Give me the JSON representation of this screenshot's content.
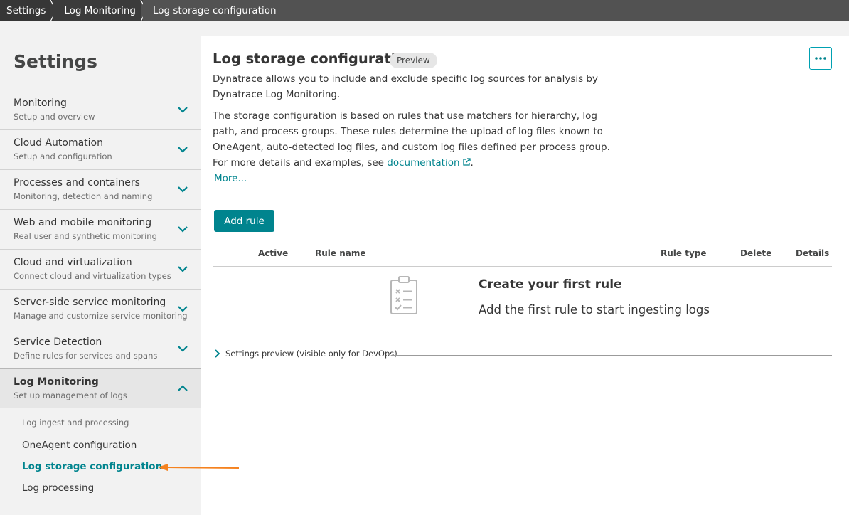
{
  "breadcrumb": {
    "items": [
      "Settings",
      "Log Monitoring",
      "Log storage configuration"
    ]
  },
  "sidebar": {
    "title": "Settings",
    "items": [
      {
        "label": "Monitoring",
        "sub": "Setup and overview"
      },
      {
        "label": "Cloud Automation",
        "sub": "Setup and configuration"
      },
      {
        "label": "Processes and containers",
        "sub": "Monitoring, detection and naming"
      },
      {
        "label": "Web and mobile monitoring",
        "sub": "Real user and synthetic monitoring"
      },
      {
        "label": "Cloud and virtualization",
        "sub": "Connect cloud and virtualization types"
      },
      {
        "label": "Server-side service monitoring",
        "sub": "Manage and customize service monitoring"
      },
      {
        "label": "Service Detection",
        "sub": "Define rules for services and spans"
      },
      {
        "label": "Log Monitoring",
        "sub": "Set up management of logs"
      }
    ],
    "subnav": {
      "header": "Log ingest and processing",
      "links": [
        "OneAgent configuration",
        "Log storage configuration",
        "Log processing"
      ]
    }
  },
  "main": {
    "title": "Log storage configuration",
    "badge": "Preview",
    "desc1": "Dynatrace allows you to include and exclude specific log sources for analysis by Dynatrace Log Monitoring.",
    "desc2_prefix": "The storage configuration is based on rules that use matchers for hierarchy, log path, and process groups. These rules determine the upload of log files known to OneAgent, auto-detected log files, and custom log files defined per process group. For more details and examples, see ",
    "desc2_link": "documentation",
    "desc2_suffix": ".",
    "more": "More...",
    "add_rule": "Add rule",
    "columns": [
      "Active",
      "Rule name",
      "Rule type",
      "Delete",
      "Details"
    ],
    "empty_title": "Create your first rule",
    "empty_sub": "Add the first rule to start ingesting logs",
    "preview_label": "Settings preview (visible only for DevOps)"
  },
  "colors": {
    "accent": "#00848e",
    "annotation_arrow": "#f5821f"
  }
}
